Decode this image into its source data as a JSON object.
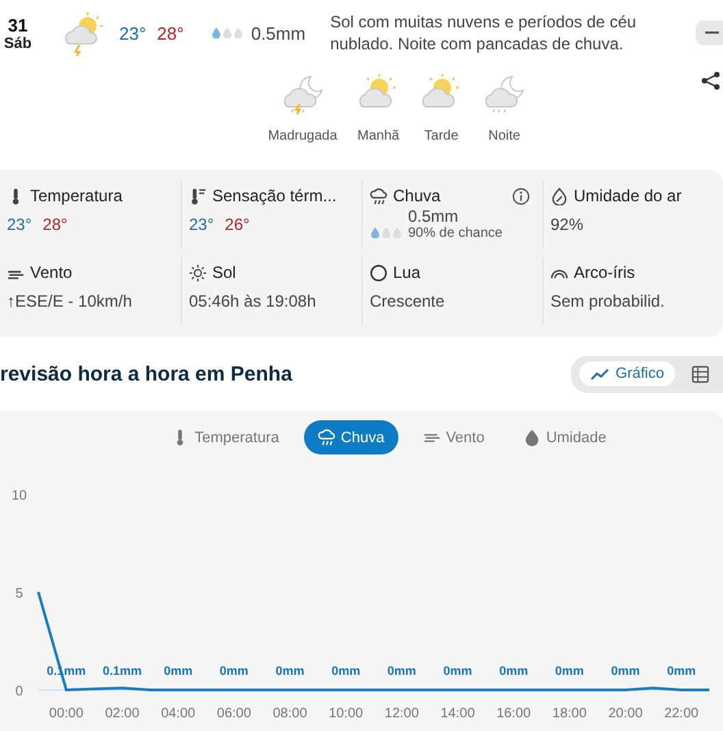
{
  "day": {
    "number": "31",
    "weekday": "Sáb",
    "min": "23°",
    "max": "28°",
    "level": 0.33,
    "rain": "0.5mm",
    "description": "Sol com muitas nuvens e períodos de céu nublado. Noite com pancadas de chuva."
  },
  "periods": [
    {
      "label": "Madrugada"
    },
    {
      "label": "Manhã"
    },
    {
      "label": "Tarde"
    },
    {
      "label": "Noite"
    }
  ],
  "stats": [
    {
      "kind": "minmax",
      "label": "Temperatura",
      "min": "23°",
      "max": "28°"
    },
    {
      "kind": "minmax",
      "label": "Sensação térm...",
      "min": "23°",
      "max": "26°"
    },
    {
      "kind": "rain",
      "label": "Chuva",
      "level": 0.33,
      "amount": "0.5mm",
      "chance": "90% de chance"
    },
    {
      "kind": "text",
      "label": "Umidade do ar",
      "value": "92%"
    },
    {
      "kind": "text",
      "label": "Vento",
      "value": "↑ESE/E - 10km/h"
    },
    {
      "kind": "text",
      "label": "Sol",
      "value": "05:46h às 19:08h"
    },
    {
      "kind": "text",
      "label": "Lua",
      "value": "Crescente"
    },
    {
      "kind": "text",
      "label": "Arco-íris",
      "value": "Sem probabilid."
    }
  ],
  "hourly": {
    "title": "revisão hora a hora em Penha",
    "views": [
      {
        "label": "Gráfico",
        "selected": true
      },
      {
        "selected": false
      }
    ],
    "tabs": [
      {
        "label": "Temperatura",
        "selected": false
      },
      {
        "label": "Chuva",
        "selected": true
      },
      {
        "label": "Vento",
        "selected": false
      },
      {
        "label": "Umidade",
        "selected": false
      }
    ],
    "chart_data": {
      "type": "line",
      "x": [
        -1,
        0,
        1,
        2,
        3,
        4,
        5,
        6,
        7,
        8,
        9,
        10,
        11,
        12,
        13,
        14,
        15,
        16,
        17,
        18,
        19,
        20,
        21,
        22,
        23
      ],
      "xlim": [
        -1,
        23
      ],
      "series": [
        {
          "color": "#1a7cc1",
          "values": [
            5,
            0,
            0.05,
            0.1,
            0,
            0,
            0,
            0,
            0,
            0,
            0,
            0,
            0,
            0,
            0,
            0,
            0,
            0,
            0,
            0,
            0,
            0,
            0.1,
            0,
            0
          ]
        }
      ],
      "ylim": [
        0,
        10
      ],
      "yticks": [
        0,
        5,
        10
      ],
      "xticks": [
        {
          "value": 0,
          "label": "00:00"
        },
        {
          "value": 2,
          "label": "02:00"
        },
        {
          "value": 4,
          "label": "04:00"
        },
        {
          "value": 6,
          "label": "06:00"
        },
        {
          "value": 8,
          "label": "08:00"
        },
        {
          "value": 10,
          "label": "10:00"
        },
        {
          "value": 12,
          "label": "12:00"
        },
        {
          "value": 14,
          "label": "14:00"
        },
        {
          "value": 16,
          "label": "16:00"
        },
        {
          "value": 18,
          "label": "18:00"
        },
        {
          "value": 20,
          "label": "20:00"
        },
        {
          "value": 22,
          "label": "22:00"
        }
      ],
      "value_labels": [
        "0.1mm",
        "0.1mm",
        "0mm",
        "0mm",
        "0mm",
        "0mm",
        "0mm",
        "0mm",
        "0mm",
        "0mm",
        "0mm",
        "0mm"
      ]
    }
  }
}
